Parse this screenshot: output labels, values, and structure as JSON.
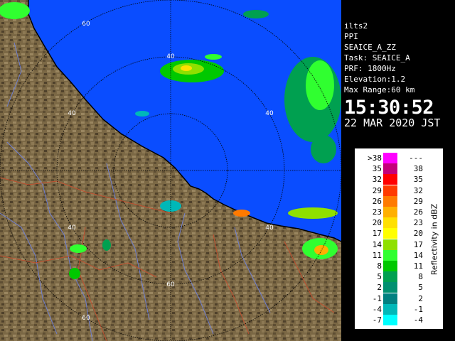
{
  "colors": {
    "sea": "#0a4dff",
    "land": "#7b6845",
    "ring": "#000000",
    "coast": "#000000"
  },
  "radar": {
    "name": "ilts2",
    "scan_type": "PPI",
    "product": "SEAICE_A_ZZ",
    "task": "Task: SEAICE_A",
    "prf": "PRF: 1800Hz",
    "elevation": "Elevation:1.2",
    "max_range": "Max Range:60 km",
    "time": "15:30:52",
    "date": "22 MAR 2020 JST"
  },
  "range_labels": [
    "40",
    "60",
    "40",
    "40",
    "40",
    "40",
    "60"
  ],
  "legend": {
    "title": "Reflectivity in dBZ",
    "rows": [
      {
        "low": ">38",
        "high": "---",
        "color": "#ff00ff"
      },
      {
        "low": "35",
        "high": "38",
        "color": "#c4007a"
      },
      {
        "low": "32",
        "high": "35",
        "color": "#ff0000"
      },
      {
        "low": "29",
        "high": "32",
        "color": "#ff3a00"
      },
      {
        "low": "26",
        "high": "29",
        "color": "#ff7a00"
      },
      {
        "low": "23",
        "high": "26",
        "color": "#ffb000"
      },
      {
        "low": "20",
        "high": "23",
        "color": "#ffe000"
      },
      {
        "low": "17",
        "high": "20",
        "color": "#ffff00"
      },
      {
        "low": "14",
        "high": "17",
        "color": "#8fe000"
      },
      {
        "low": "11",
        "high": "14",
        "color": "#30ff30"
      },
      {
        "low": "8",
        "high": "11",
        "color": "#00c800"
      },
      {
        "low": "5",
        "high": "8",
        "color": "#00a050"
      },
      {
        "low": "2",
        "high": "5",
        "color": "#009070"
      },
      {
        "low": "-1",
        "high": "2",
        "color": "#008080"
      },
      {
        "low": "-4",
        "high": "-1",
        "color": "#00b8b8"
      },
      {
        "low": "-7",
        "high": "-4",
        "color": "#00ffff"
      }
    ]
  }
}
